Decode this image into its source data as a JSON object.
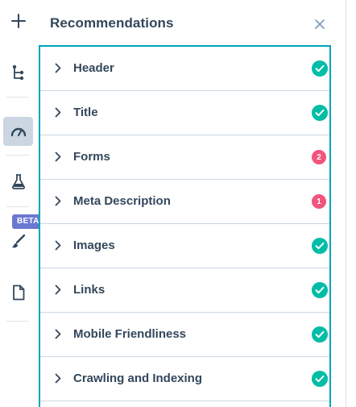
{
  "toolbar": {
    "items": [
      {
        "icon": "plus-icon"
      },
      {
        "icon": "hierarchy-icon"
      },
      {
        "icon": "gauge-icon",
        "active": true
      },
      {
        "icon": "flask-icon"
      },
      {
        "icon": "brush-icon"
      },
      {
        "icon": "document-icon"
      }
    ],
    "beta_label": "BETA"
  },
  "panel": {
    "title": "Recommendations",
    "close_icon": "close-icon"
  },
  "recommendations": [
    {
      "label": "Header",
      "status": "ok"
    },
    {
      "label": "Title",
      "status": "ok"
    },
    {
      "label": "Forms",
      "status": "issues",
      "count": "2"
    },
    {
      "label": "Meta Description",
      "status": "issues",
      "count": "1"
    },
    {
      "label": "Images",
      "status": "ok"
    },
    {
      "label": "Links",
      "status": "ok"
    },
    {
      "label": "Mobile Friendliness",
      "status": "ok"
    },
    {
      "label": "Crawling and Indexing",
      "status": "ok"
    }
  ],
  "colors": {
    "accent_border": "#00a4bd",
    "ok": "#00bda5",
    "issue": "#f2547d",
    "beta": "#6a78d1",
    "text": "#33475b"
  }
}
